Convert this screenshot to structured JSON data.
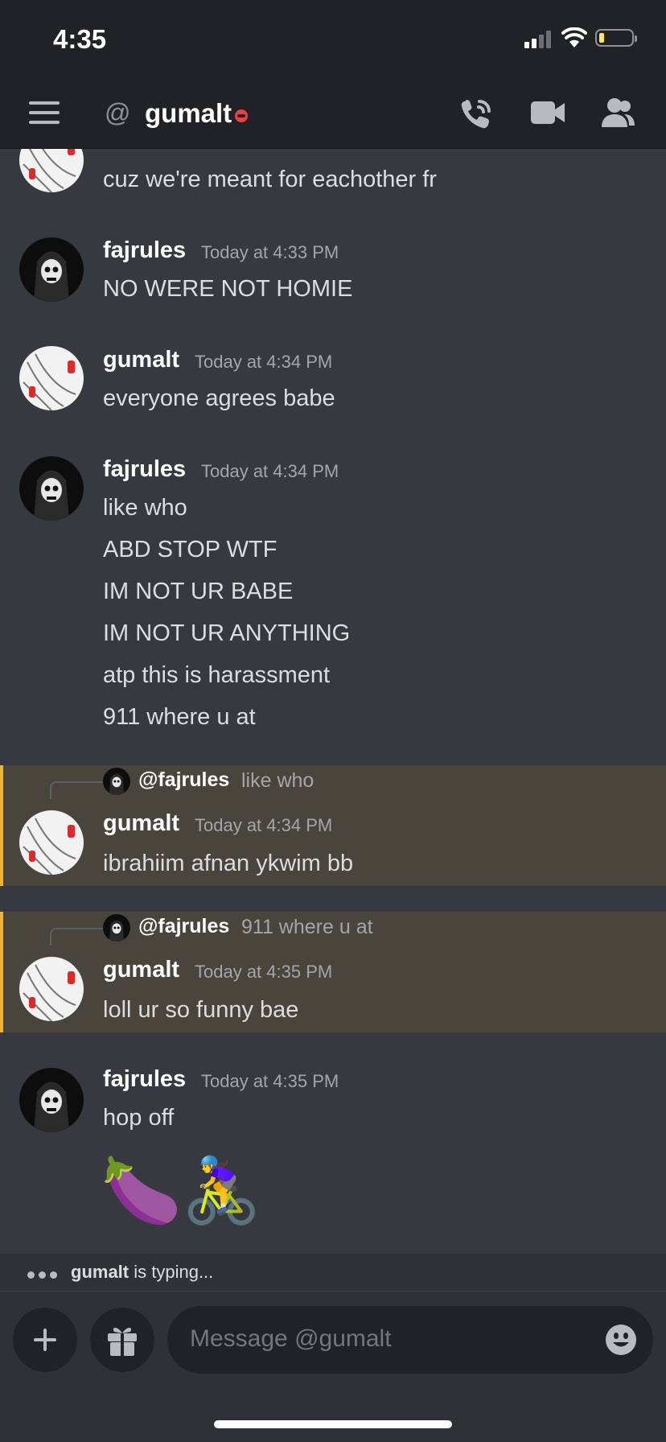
{
  "status_bar": {
    "time": "4:35"
  },
  "header": {
    "at_symbol": "@",
    "channel_name": "gumalt"
  },
  "messages": {
    "cut_off_line": "cuz we're meant for eachother fr",
    "m1": {
      "author": "fajrules",
      "timestamp": "Today at 4:33 PM",
      "lines": [
        "NO WERE NOT HOMIE"
      ]
    },
    "m2": {
      "author": "gumalt",
      "timestamp": "Today at 4:34 PM",
      "lines": [
        "everyone agrees babe"
      ]
    },
    "m3": {
      "author": "fajrules",
      "timestamp": "Today at 4:34 PM",
      "lines": [
        "like who",
        "ABD STOP WTF",
        "IM NOT UR BABE",
        "IM NOT UR ANYTHING",
        "atp this is harassment",
        "911 where u at"
      ]
    },
    "m4": {
      "reply_to": "@fajrules",
      "reply_text": "like who",
      "author": "gumalt",
      "timestamp": "Today at 4:34 PM",
      "lines": [
        "ibrahiim afnan ykwim bb"
      ]
    },
    "m5": {
      "reply_to": "@fajrules",
      "reply_text": "911 where u at",
      "author": "gumalt",
      "timestamp": "Today at 4:35 PM",
      "lines": [
        "loll ur so funny bae"
      ]
    },
    "m6": {
      "author": "fajrules",
      "timestamp": "Today at 4:35 PM",
      "lines": [
        "hop off"
      ],
      "emoji": "🍆🚴‍♀️"
    }
  },
  "typing": {
    "user": "gumalt",
    "suffix": " is typing..."
  },
  "composer": {
    "placeholder": "Message @gumalt"
  },
  "colors": {
    "background": "#36393f",
    "header": "#202225",
    "mention_highlight": "#49443c",
    "mention_bar": "#f0b232",
    "dnd_status": "#ed4245"
  }
}
